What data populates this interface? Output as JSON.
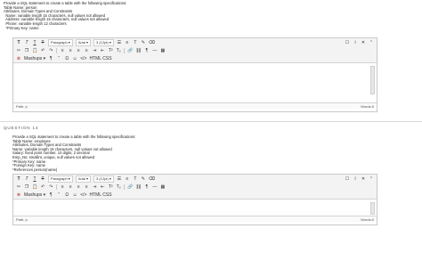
{
  "question_13": {
    "prompt_lines": [
      "Provide a SQL statement to create a table with the following specifications:",
      "Table Name: person",
      "Attributes, Domain Types and Constraints",
      "  Name: variable length 15 characters, null values not allowed",
      "  Address: variable length 15 characters, null values not allowed",
      "  Phone: variable length 12 characters",
      "  *Primary Key: name"
    ],
    "status_path": "Path: p",
    "status_words": "Words:0"
  },
  "question_14": {
    "header": "QUESTION 14",
    "prompt_lines": [
      "Provide a SQL statement to create a table with the following specifications:",
      "Table Name: employee",
      "Attributes, Domain Types and Constraints",
      "Name: variable length 15 characters, null values not allowed",
      "Salary: fixed point number, 10 digits, 2 decimal",
      "Emp_No: smallint, unique, null values not allowed",
      "*Primary Key: name",
      "*Foreign Key: name",
      "*References person(name)"
    ],
    "status_path": "Path: p",
    "status_words": "Words:0"
  },
  "toolbar": {
    "paragraph": "Paragraph",
    "font": "Arial",
    "size": "3 (12pt)",
    "mashups": "Mashups",
    "html_css": "HTML CSS"
  }
}
